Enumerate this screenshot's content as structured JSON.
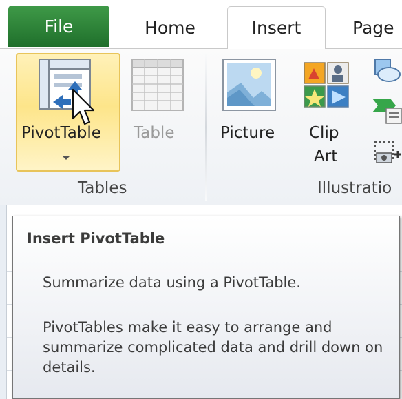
{
  "tabs": {
    "file": "File",
    "home": "Home",
    "insert": "Insert",
    "page": "Page"
  },
  "ribbon": {
    "tables_group": {
      "label": "Tables",
      "pivottable_label": "PivotTable",
      "table_label": "Table"
    },
    "illustrations_group": {
      "label": "Illustratio",
      "picture_label": "Picture",
      "clipart_label_line1": "Clip",
      "clipart_label_line2": "Art"
    }
  },
  "tooltip": {
    "title": "Insert PivotTable",
    "summary": "Summarize data using a PivotTable.",
    "description": "PivotTables make it easy to arrange and summarize complicated data and drill down on details."
  },
  "colors": {
    "file_tab": "#2a7d34",
    "hover_button": "#fde58a",
    "tooltip_border": "#767676"
  },
  "icons": [
    "pivottable-icon",
    "table-icon",
    "picture-icon",
    "clipart-icon",
    "shapes-icon",
    "smartart-icon",
    "screenshot-icon",
    "mouse-cursor-icon"
  ]
}
